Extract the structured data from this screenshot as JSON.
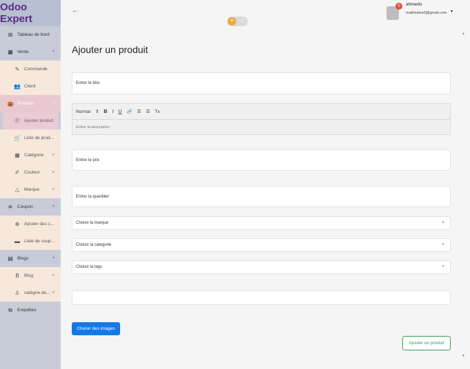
{
  "brand": "Odoo Expert",
  "sidebar": {
    "items": [
      {
        "label": "Tableau de bord",
        "icon": "dashboard-icon",
        "glyph": "⊞",
        "type": "sec",
        "chev": ""
      },
      {
        "label": "Vente",
        "icon": "sales-icon",
        "glyph": "▦",
        "type": "sec",
        "chev": "^"
      },
      {
        "label": "Commande",
        "icon": "pencil-icon",
        "glyph": "✎",
        "type": "sub",
        "chev": ""
      },
      {
        "label": "Client",
        "icon": "users-icon",
        "glyph": "👥",
        "type": "sub",
        "chev": ""
      },
      {
        "label": "Produits",
        "icon": "bag-icon",
        "glyph": "👜",
        "type": "active-sec",
        "chev": "^"
      },
      {
        "label": "Ajouter produit",
        "icon": "product-icon",
        "glyph": "Ⓟ",
        "type": "active",
        "chev": ""
      },
      {
        "label": "Liste de prod...",
        "icon": "cart-icon",
        "glyph": "🛒",
        "type": "sub",
        "chev": ""
      },
      {
        "label": "Catégorie",
        "icon": "grid-icon",
        "glyph": "▦",
        "type": "sub",
        "chev": "˅"
      },
      {
        "label": "Couleur",
        "icon": "brush-icon",
        "glyph": "✐",
        "type": "sub",
        "chev": "˅"
      },
      {
        "label": "Marque",
        "icon": "brand-icon",
        "glyph": "△",
        "type": "sub",
        "chev": "˅"
      },
      {
        "label": "Coupon",
        "icon": "layers-icon",
        "glyph": "≋",
        "type": "sec",
        "chev": "^"
      },
      {
        "label": "Ajouter des c...",
        "icon": "add-coupon-icon",
        "glyph": "⊕",
        "type": "sub",
        "chev": ""
      },
      {
        "label": "Liste de coup...",
        "icon": "ticket-icon",
        "glyph": "▬",
        "type": "sub",
        "chev": ""
      },
      {
        "label": "Blogs",
        "icon": "blog-icon",
        "glyph": "▤",
        "type": "sec",
        "chev": "^"
      },
      {
        "label": "Blog",
        "icon": "b-icon",
        "glyph": "B",
        "type": "sub",
        "chev": "˅"
      },
      {
        "label": "catégrie de...",
        "icon": "category-icon",
        "glyph": "♙",
        "type": "sub",
        "chev": "˅"
      },
      {
        "label": "Enquêtes",
        "icon": "survey-icon",
        "glyph": "⧉",
        "type": "sec",
        "chev": ""
      }
    ]
  },
  "header": {
    "back": "←",
    "badge_count": "0",
    "user_name": "ahmedo",
    "user_email": "mathtubes0@gmail.com",
    "caret": "▾"
  },
  "page": {
    "title": "Ajouter un produit",
    "title_placeholder": "Entrer le titre",
    "editor": {
      "format": "Normal",
      "bold": "B",
      "italic": "I",
      "underline": "U",
      "link": "🔗",
      "ol": "☰",
      "ul": "☰",
      "clear": "Tx",
      "placeholder": "Entrer la description"
    },
    "price_placeholder": "Entrer le prix",
    "quantity_placeholder": "Entrer la quantiter",
    "brand_select": "Choisir la marque",
    "category_select": "Choisir la categorie",
    "tags_select": "Choisir la tags",
    "extra_value": "",
    "images_button": "Choisir des images",
    "submit_button": "Ajouter un produit"
  }
}
